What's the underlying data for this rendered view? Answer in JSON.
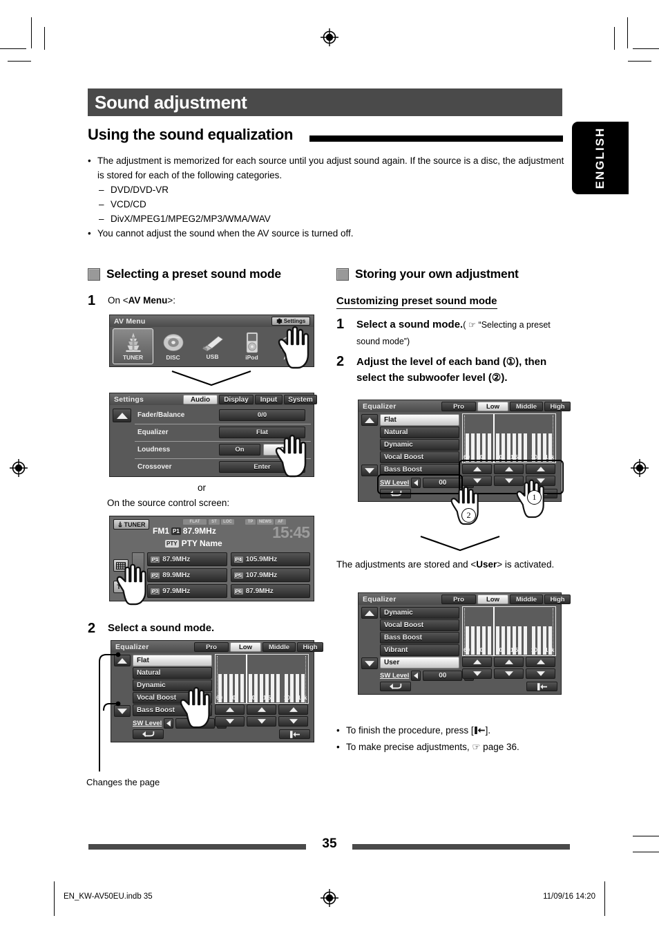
{
  "page": {
    "chapter_title": "Sound adjustment",
    "section_title": "Using the sound equalization",
    "language_tab": "ENGLISH",
    "page_number": "35"
  },
  "intro": {
    "bullet1": "The adjustment is memorized for each source until you adjust sound again. If the source is a disc, the adjustment is stored for each of the following categories.",
    "sub_items": [
      "DVD/DVD-VR",
      "VCD/CD",
      "DivX/MPEG1/MPEG2/MP3/WMA/WAV"
    ],
    "bullet2": "You cannot adjust the sound when the AV source is turned off."
  },
  "left_column": {
    "heading": "Selecting a preset sound mode",
    "step1": {
      "number": "1",
      "text_pre": "On <",
      "text_bold": "AV Menu",
      "text_post": ">:"
    },
    "av_menu_screen": {
      "title": "AV Menu",
      "settings_button": "Settings",
      "sources": [
        "TUNER",
        "DISC",
        "USB",
        "iPod",
        "AV-IN"
      ],
      "selected_source": "TUNER"
    },
    "settings_screen": {
      "title": "Settings",
      "tabs": [
        "Audio",
        "Display",
        "Input",
        "System"
      ],
      "selected_tab": "Audio",
      "rows": [
        {
          "label": "Fader/Balance",
          "value": "0/0"
        },
        {
          "label": "Equalizer",
          "value": "Flat"
        },
        {
          "label": "Loudness",
          "value": "On",
          "value2": "Off"
        },
        {
          "label": "Crossover",
          "value": "Enter"
        }
      ]
    },
    "or_text": "or",
    "source_screen_caption": "On the source control screen:",
    "tuner_screen": {
      "source_label": "TUNER",
      "band": "FM1",
      "preset_badge": "P1",
      "frequency": "87.9MHz",
      "pty_badge": "PTY",
      "pty_text": "PTY Name",
      "clock": "15:45",
      "indicators": [
        "FLAT",
        "ST",
        "LOC",
        "TP",
        "NEWS",
        "AF"
      ],
      "presets": [
        {
          "badge": "P1",
          "freq": "87.9MHz"
        },
        {
          "badge": "P4",
          "freq": "105.9MHz"
        },
        {
          "badge": "P2",
          "freq": "89.9MHz"
        },
        {
          "badge": "P5",
          "freq": "107.9MHz"
        },
        {
          "badge": "P3",
          "freq": "97.9MHz"
        },
        {
          "badge": "P6",
          "freq": "87.9MHz"
        }
      ],
      "tp_button": "TP"
    },
    "step2": {
      "number": "2",
      "text": "Select a sound mode."
    },
    "eq_screen": {
      "title": "Equalizer",
      "tabs": [
        "Pro",
        "Low",
        "Middle",
        "High"
      ],
      "selected_tab": "Low",
      "modes": [
        "Flat",
        "Natural",
        "Dynamic",
        "Vocal Boost",
        "Bass Boost"
      ],
      "selected_mode": "Flat",
      "sw_level_label": "SW Level",
      "sw_level_value": "00",
      "freq_labels": [
        "60",
        "100",
        "500",
        "1.5k",
        "10k",
        "15k"
      ]
    },
    "caption_changes_page": "Changes the page"
  },
  "right_column": {
    "heading": "Storing your own adjustment",
    "subheading": "Customizing preset sound mode",
    "step1": {
      "number": "1",
      "bold": "Select a sound mode.",
      "normal": "( ☞ “Selecting a preset sound mode”)"
    },
    "step2": {
      "number": "2",
      "line1": "Adjust the level of each band (①), then",
      "line2": "select the subwoofer level (②)."
    },
    "eq_screen_a": {
      "title": "Equalizer",
      "tabs": [
        "Pro",
        "Low",
        "Middle",
        "High"
      ],
      "selected_tab": "Low",
      "modes": [
        "Flat",
        "Natural",
        "Dynamic",
        "Vocal Boost",
        "Bass Boost"
      ],
      "selected_mode": "Flat",
      "sw_level_label": "SW Level",
      "sw_level_value": "00",
      "freq_labels": [
        "60",
        "100",
        "500",
        "1.5k",
        "10k",
        "15k"
      ],
      "callout_1": "1",
      "callout_2": "2"
    },
    "result_text_pre": "The adjustments are stored and <",
    "result_bold": "User",
    "result_text_post": "> is activated.",
    "eq_screen_b": {
      "title": "Equalizer",
      "tabs": [
        "Pro",
        "Low",
        "Middle",
        "High"
      ],
      "selected_tab": "Low",
      "modes": [
        "Dynamic",
        "Vocal Boost",
        "Bass Boost",
        "Vibrant",
        "User"
      ],
      "selected_mode": "User",
      "sw_level_label": "SW Level",
      "sw_level_value": "00",
      "freq_labels": [
        "60",
        "100",
        "500",
        "1.5k",
        "10k",
        "15k"
      ]
    },
    "notes": [
      "To finish the procedure, press [⏎].",
      "To make precise adjustments, ☞ page 36."
    ],
    "note1_pre": "To finish the procedure, press [",
    "note1_post": "].",
    "note2": "To make precise adjustments, ☞ page 36."
  },
  "footer": {
    "file": "EN_KW-AV50EU.indb   35",
    "timestamp": "11/09/16   14:20"
  },
  "colors": {
    "chapter_bar": "#4a4a4a",
    "screen_bg": "#595959",
    "accent_black": "#000000"
  }
}
